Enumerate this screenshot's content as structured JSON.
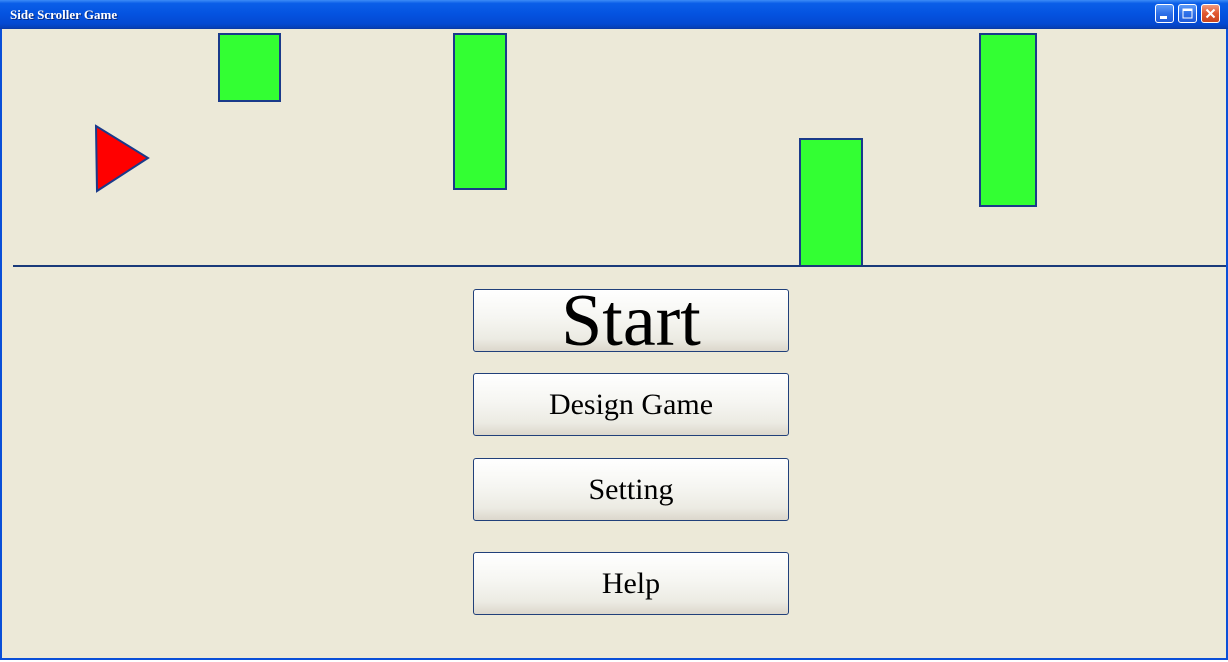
{
  "window": {
    "title": "Side Scroller Game"
  },
  "titlebar_buttons": {
    "minimize_icon": "minimize-icon",
    "maximize_icon": "maximize-icon",
    "close_icon": "close-icon"
  },
  "game": {
    "player_color": "#ff0000",
    "obstacle_color": "#33ff33",
    "outline_color": "#1a3a8a",
    "background_color": "#ece9d8"
  },
  "menu": {
    "start_label": "Start",
    "design_label": "Design Game",
    "setting_label": "Setting",
    "help_label": "Help"
  }
}
